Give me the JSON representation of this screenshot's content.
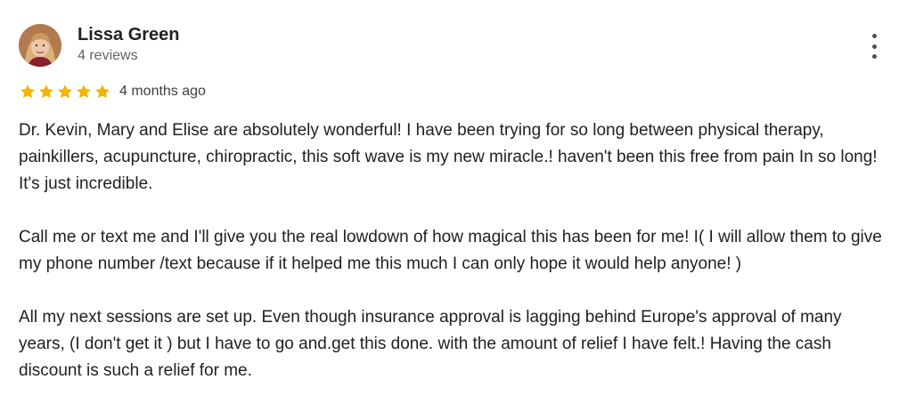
{
  "review": {
    "reviewer_name": "Lissa Green",
    "review_count": "4 reviews",
    "rating": 5,
    "date": "4 months ago",
    "star_color": "#f4b400",
    "more_icon": "more-vert-icon",
    "avatar_icon": "reviewer-avatar",
    "paragraphs": [
      "Dr. Kevin, Mary and Elise are absolutely wonderful! I have been trying for so long between physical therapy, painkillers, acupuncture, chiropractic, this soft wave is my new miracle.! haven't been this free from pain In so long! It's just incredible.",
      "Call me or text me and I'll give you the real lowdown of how magical this has been for me! I( I will allow them to give my phone number /text because if it helped me this much I can only hope it would help anyone! )",
      "All my next sessions are set up. Even though insurance approval is lagging behind Europe's approval of many years, (I don't get it ) but I have to go and.get this done. with the amount of relief I have felt.! Having the cash discount is such a relief for me."
    ]
  }
}
